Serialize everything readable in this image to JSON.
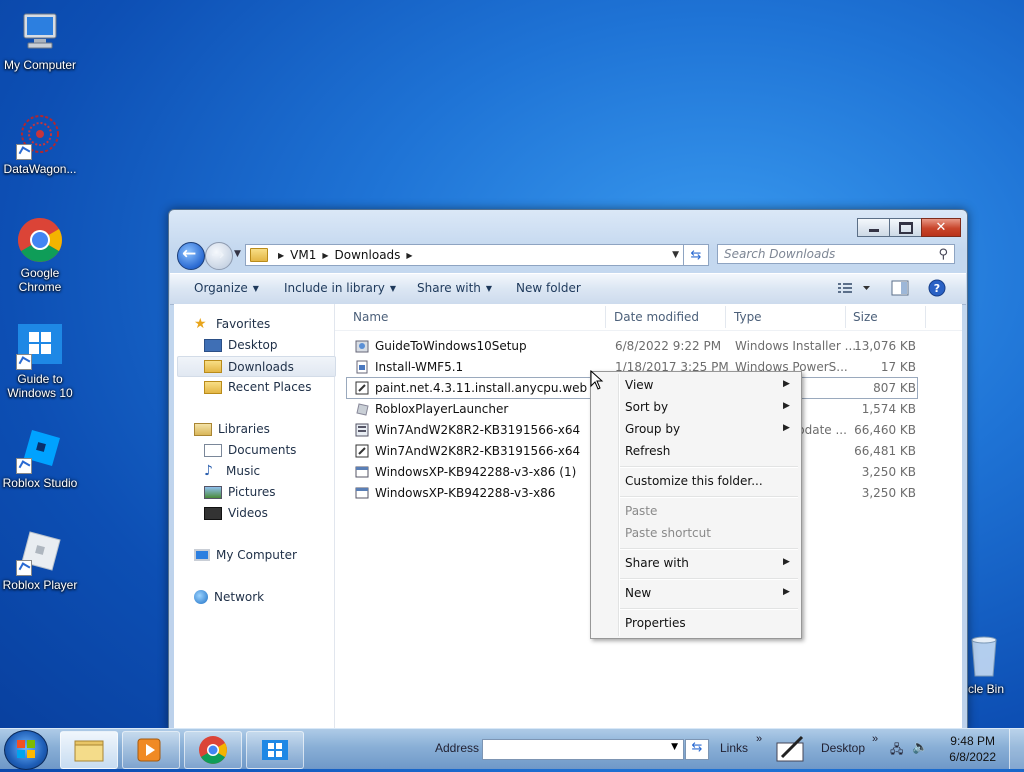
{
  "desktop": {
    "icons": [
      {
        "label": "My Computer"
      },
      {
        "label": "DataWagon..."
      },
      {
        "label": "Google Chrome"
      },
      {
        "label": "Guide to Windows 10"
      },
      {
        "label": "Roblox Studio"
      },
      {
        "label": "Roblox Player"
      },
      {
        "label": "ycle Bin"
      }
    ]
  },
  "window": {
    "breadcrumb": [
      "VM1",
      "Downloads"
    ],
    "search_placeholder": "Search Downloads",
    "toolbar": {
      "organize": "Organize",
      "include_in_library": "Include in library",
      "share_with": "Share with",
      "new_folder": "New folder"
    },
    "nav": {
      "favorites": "Favorites",
      "desktop": "Desktop",
      "downloads": "Downloads",
      "recent_places": "Recent Places",
      "libraries": "Libraries",
      "documents": "Documents",
      "music": "Music",
      "pictures": "Pictures",
      "videos": "Videos",
      "my_computer": "My Computer",
      "network": "Network"
    },
    "columns": {
      "name": "Name",
      "date": "Date modified",
      "type": "Type",
      "size": "Size"
    },
    "files": [
      {
        "name": "GuideToWindows10Setup",
        "date": "6/8/2022 9:22 PM",
        "type": "Windows Installer ...",
        "size": "13,076 KB",
        "icon": "installer-icon"
      },
      {
        "name": "Install-WMF5.1",
        "date": "1/18/2017 3:25 PM",
        "type": "Windows PowerS...",
        "size": "17 KB",
        "icon": "script-icon"
      },
      {
        "name": "paint.net.4.3.11.install.anycpu.web",
        "date": "",
        "type": "",
        "size": "807 KB",
        "icon": "exe-icon"
      },
      {
        "name": "RobloxPlayerLauncher",
        "date": "",
        "type": "",
        "size": "1,574 KB",
        "icon": "roblox-icon"
      },
      {
        "name": "Win7AndW2K8R2-KB3191566-x64",
        "date": "",
        "type": "pdate ...",
        "size": "66,460 KB",
        "icon": "update-icon"
      },
      {
        "name": "Win7AndW2K8R2-KB3191566-x64",
        "date": "",
        "type": "",
        "size": "66,481 KB",
        "icon": "zip-icon"
      },
      {
        "name": "WindowsXP-KB942288-v3-x86 (1)",
        "date": "",
        "type": "",
        "size": "3,250 KB",
        "icon": "exe-icon"
      },
      {
        "name": "WindowsXP-KB942288-v3-x86",
        "date": "",
        "type": "",
        "size": "3,250 KB",
        "icon": "exe-icon"
      }
    ]
  },
  "context_menu": {
    "view": "View",
    "sort_by": "Sort by",
    "group_by": "Group by",
    "refresh": "Refresh",
    "customize": "Customize this folder...",
    "paste": "Paste",
    "paste_shortcut": "Paste shortcut",
    "share_with": "Share with",
    "new": "New",
    "properties": "Properties"
  },
  "taskbar": {
    "address_label": "Address",
    "links_label": "Links",
    "desktop_label": "Desktop",
    "time": "9:48 PM",
    "date": "6/8/2022"
  }
}
